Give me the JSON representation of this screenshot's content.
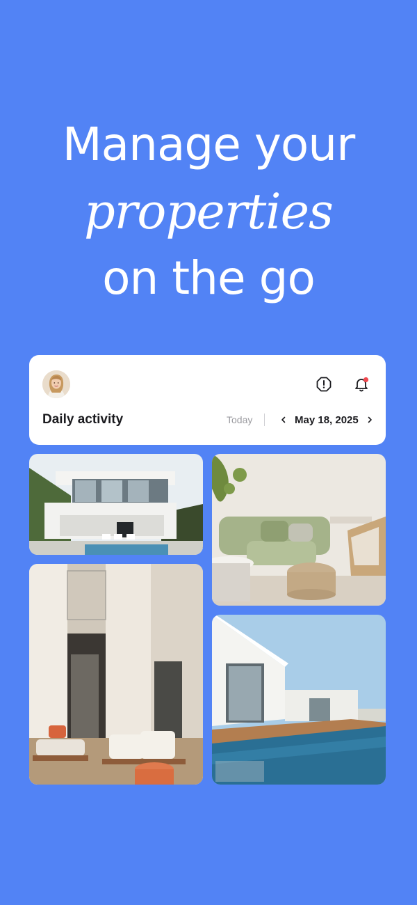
{
  "headline": {
    "line1": "Manage your",
    "line2": "properties",
    "line3": "on the go"
  },
  "card": {
    "title": "Daily activity",
    "today_label": "Today",
    "date": "May 18, 2025"
  },
  "icons": {
    "alert": "alert-octagon-icon",
    "bell": "bell-icon",
    "prev": "chevron-left-icon",
    "next": "chevron-right-icon"
  },
  "colors": {
    "background": "#5283f5",
    "notification_dot": "#f0484f"
  }
}
